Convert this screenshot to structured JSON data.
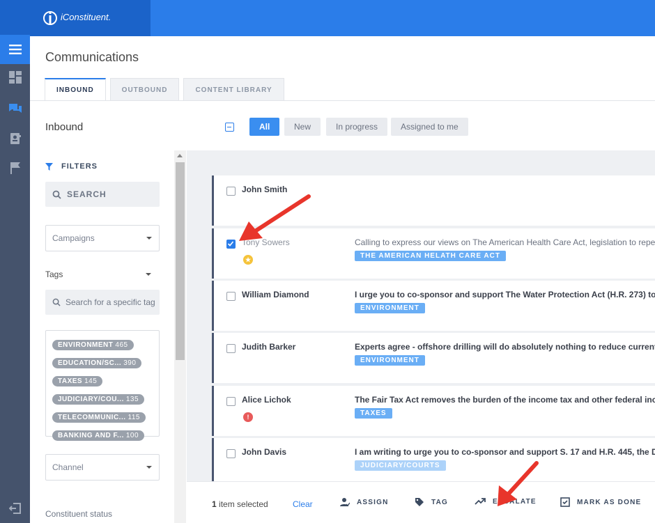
{
  "app": {
    "brand": "iConstituent."
  },
  "page": {
    "title": "Communications"
  },
  "tabs": [
    {
      "label": "INBOUND",
      "active": true
    },
    {
      "label": "OUTBOUND",
      "active": false
    },
    {
      "label": "CONTENT LIBRARY",
      "active": false
    }
  ],
  "sidebar": {
    "title": "Inbound",
    "filters_label": "FILTERS",
    "search_label": "SEARCH",
    "campaigns_placeholder": "Campaigns",
    "tags_label": "Tags",
    "tag_search_placeholder": "Search for a specific tag",
    "tags": [
      {
        "name": "ENVIRONMENT",
        "count": "465"
      },
      {
        "name": "EDUCATION/SC...",
        "count": "390"
      },
      {
        "name": "TAXES",
        "count": "145"
      },
      {
        "name": "JUDICIARY/COU...",
        "count": "135"
      },
      {
        "name": "TELECOMMUNIC...",
        "count": "115"
      },
      {
        "name": "BANKING AND F...",
        "count": "100"
      }
    ],
    "channel_placeholder": "Channel",
    "constituent_status_label": "Constituent status"
  },
  "segments": [
    {
      "label": "All",
      "active": true
    },
    {
      "label": "New",
      "active": false
    },
    {
      "label": "In progress",
      "active": false
    },
    {
      "label": "Assigned to me",
      "active": false
    }
  ],
  "messages": [
    {
      "name": "John Smith",
      "message": "",
      "tag": "",
      "checked": false,
      "badge": ""
    },
    {
      "name": "Tony Sowers",
      "message": "Calling to express our views on The American Health Care Act, legislation to repeal and replace",
      "tag": "THE AMERICAN HELATH CARE ACT",
      "checked": true,
      "badge": "star"
    },
    {
      "name": "William Diamond",
      "message": "I urge you to co-sponsor and support The Water Protection Act (H.R. 273) to help protect our waters",
      "tag": "ENVIRONMENT",
      "checked": false,
      "badge": ""
    },
    {
      "name": "Judith Barker",
      "message": "Experts agree - offshore drilling will do absolutely nothing to reduce current gas prices",
      "tag": "ENVIRONMENT",
      "checked": false,
      "badge": ""
    },
    {
      "name": "Alice Lichok",
      "message": "The Fair Tax Act removes the burden of the income tax and other federal income-based taxes",
      "tag": "TAXES",
      "checked": false,
      "badge": "alert"
    },
    {
      "name": "John Davis",
      "message": "I am writing to urge you to co-sponsor and support S. 17 and H.R. 445, the Drug Sentencing Reform",
      "tag": "JUDICIARY/COURTS",
      "checked": false,
      "badge": ""
    }
  ],
  "actionbar": {
    "count": "1",
    "selected_text": "item selected",
    "clear": "Clear",
    "assign": "ASSIGN",
    "tag": "TAG",
    "escalate": "ESCALATE",
    "done": "MARK AS DONE"
  },
  "colors": {
    "primary": "#2b7de9",
    "rail": "#45536c",
    "tag_blue": "#6aaef5",
    "annotation_red": "#e8352b",
    "star_badge": "#f5c33b",
    "alert_badge": "#e85a5a"
  }
}
